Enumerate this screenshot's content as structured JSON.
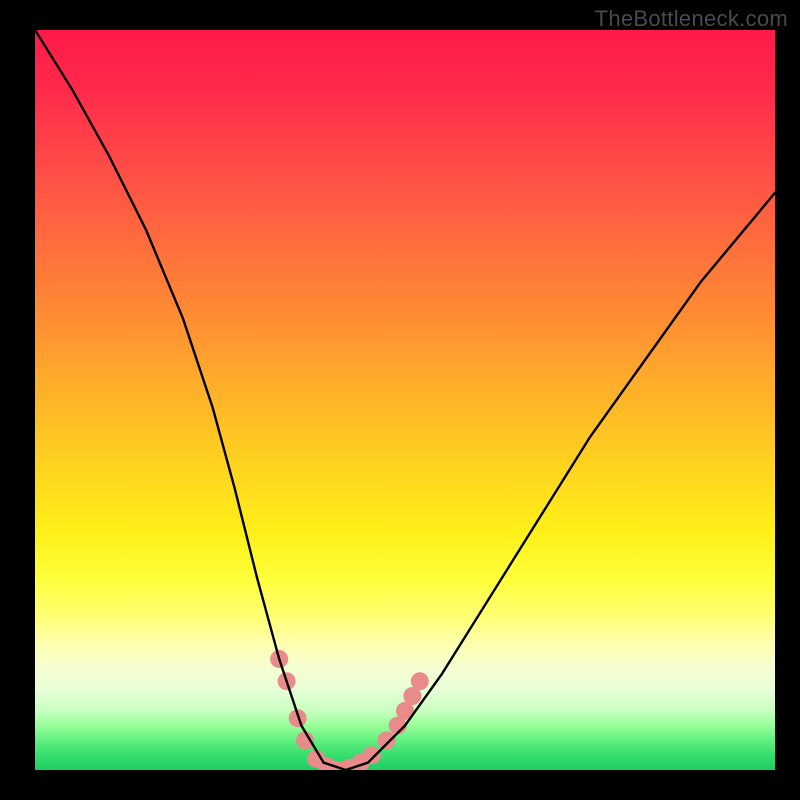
{
  "watermark": {
    "text": "TheBottleneck.com"
  },
  "chart_data": {
    "type": "line",
    "title": "",
    "xlabel": "",
    "ylabel": "",
    "xlim": [
      0,
      1
    ],
    "ylim": [
      0,
      100
    ],
    "grid": false,
    "gradient_stops": [
      {
        "pos": 0.0,
        "color": "#ff1a4a"
      },
      {
        "pos": 0.5,
        "color": "#ffd020"
      },
      {
        "pos": 0.8,
        "color": "#ffff70"
      },
      {
        "pos": 1.0,
        "color": "#1ecf62"
      }
    ],
    "series": [
      {
        "name": "bottleneck-curve",
        "color": "#000000",
        "x": [
          0.0,
          0.05,
          0.1,
          0.15,
          0.2,
          0.24,
          0.27,
          0.3,
          0.33,
          0.36,
          0.39,
          0.42,
          0.45,
          0.5,
          0.55,
          0.6,
          0.65,
          0.7,
          0.75,
          0.8,
          0.85,
          0.9,
          0.95,
          1.0
        ],
        "values": [
          100,
          92,
          83,
          73,
          61,
          49,
          38,
          26,
          15,
          6,
          1,
          0,
          1,
          6,
          13,
          21,
          29,
          37,
          45,
          52,
          59,
          66,
          72,
          78
        ]
      }
    ],
    "markers": {
      "name": "dot-cluster",
      "color": "#e98b8b",
      "radius_px": 9,
      "points": [
        {
          "x": 0.33,
          "y": 15.0
        },
        {
          "x": 0.34,
          "y": 12.0
        },
        {
          "x": 0.355,
          "y": 7.0
        },
        {
          "x": 0.365,
          "y": 4.0
        },
        {
          "x": 0.38,
          "y": 1.5
        },
        {
          "x": 0.395,
          "y": 0.5
        },
        {
          "x": 0.41,
          "y": 0.0
        },
        {
          "x": 0.425,
          "y": 0.3
        },
        {
          "x": 0.44,
          "y": 1.0
        },
        {
          "x": 0.455,
          "y": 2.0
        },
        {
          "x": 0.475,
          "y": 4.0
        },
        {
          "x": 0.49,
          "y": 6.0
        },
        {
          "x": 0.5,
          "y": 8.0
        },
        {
          "x": 0.51,
          "y": 10.0
        },
        {
          "x": 0.52,
          "y": 12.0
        }
      ]
    }
  }
}
